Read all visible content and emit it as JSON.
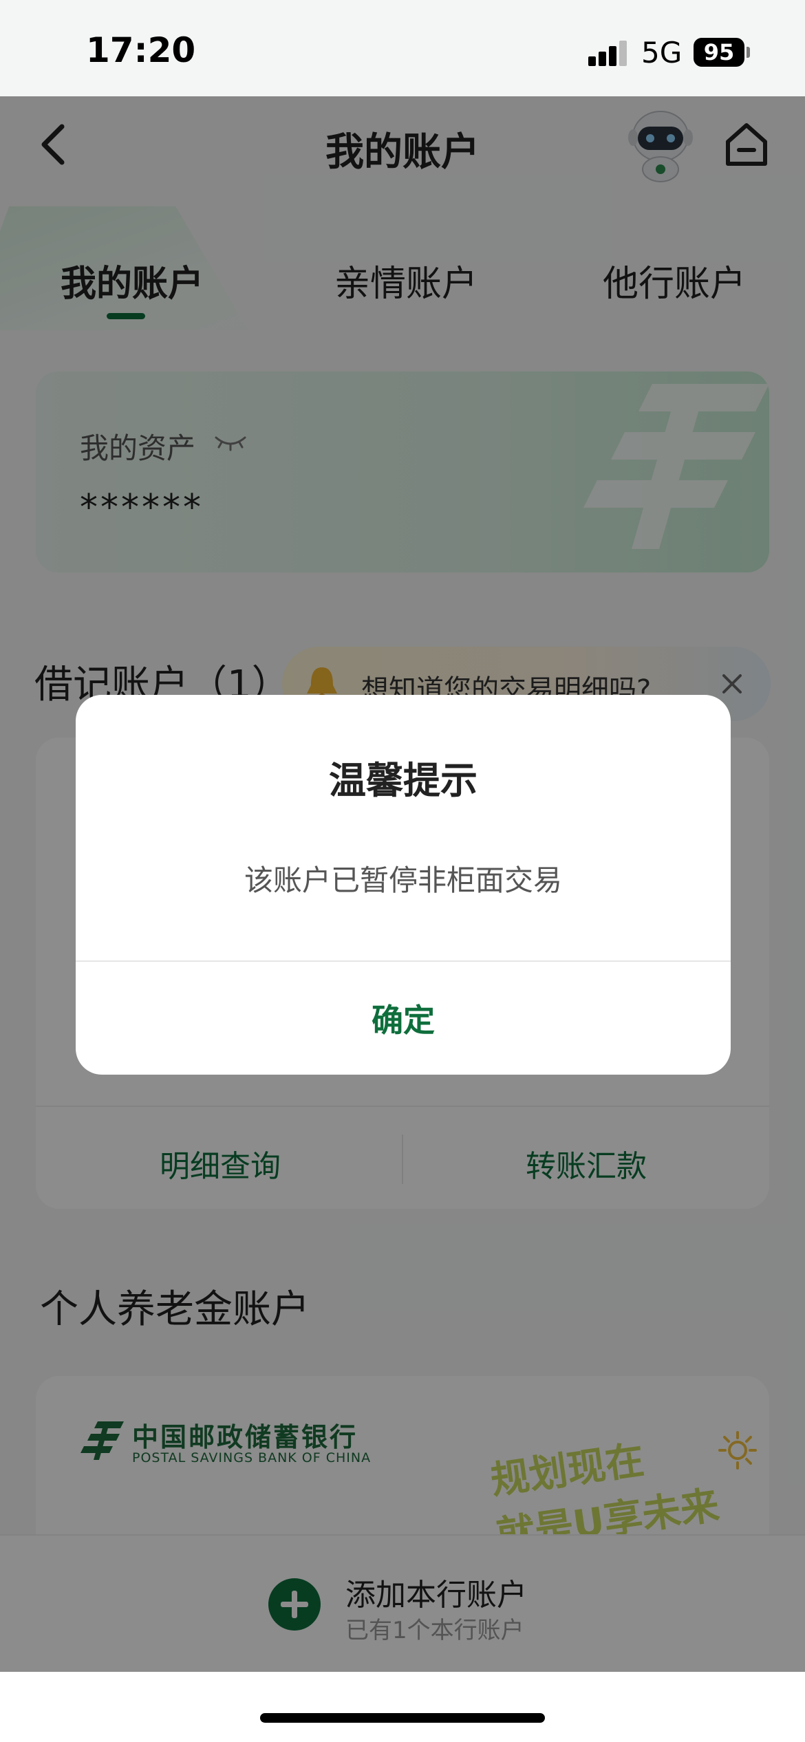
{
  "status_bar": {
    "time": "17:20",
    "network": "5G",
    "battery": "95"
  },
  "header": {
    "title": "我的账户"
  },
  "tabs": [
    {
      "label": "我的账户",
      "active": true
    },
    {
      "label": "亲情账户",
      "active": false
    },
    {
      "label": "他行账户",
      "active": false
    }
  ],
  "assets": {
    "label": "我的资产",
    "value": "******"
  },
  "debit": {
    "title": "借记账户（1）",
    "tip": "想知道您的交易明细吗?",
    "actions": {
      "details": "明细查询",
      "transfer": "转账汇款"
    }
  },
  "pension": {
    "title": "个人养老金账户",
    "bank_name_cn": "中国邮政储蓄银行",
    "bank_name_en": "POSTAL SAVINGS BANK OF CHINA",
    "slogan_line1": "规划现在",
    "slogan_line2": "就是U享未来"
  },
  "add_account": {
    "title": "添加本行账户",
    "subtitle": "已有1个本行账户"
  },
  "dialog": {
    "title": "温馨提示",
    "message": "该账户已暂停非柜面交易",
    "confirm": "确定"
  },
  "colors": {
    "accent": "#0e6e3c",
    "overlay": "rgba(0,0,0,0.45)"
  },
  "icons": [
    "back-icon",
    "robot-assistant-icon",
    "home-icon",
    "eye-closed-icon",
    "bell-icon",
    "close-icon",
    "plus-icon",
    "bank-logo-icon"
  ]
}
